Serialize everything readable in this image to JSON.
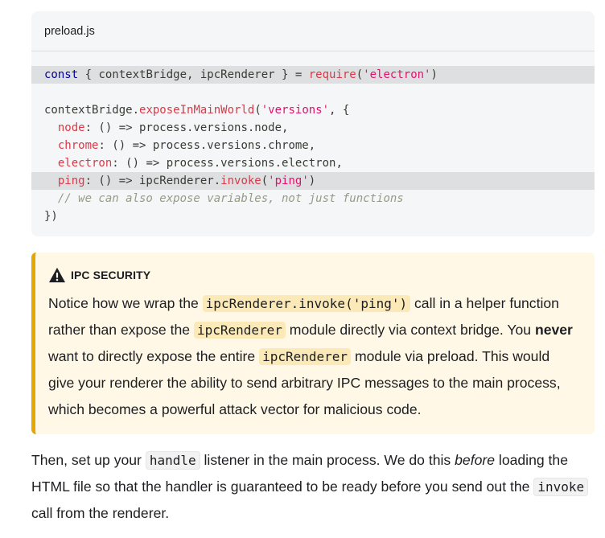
{
  "code_block": {
    "filename": "preload.js",
    "lines": {
      "l1": {
        "a": "const",
        "b": " { contextBridge, ipcRenderer } = ",
        "c": "require",
        "d": "(",
        "e": "'electron'",
        "f": ")"
      },
      "l3": {
        "a": "contextBridge.",
        "b": "exposeInMainWorld",
        "c": "(",
        "d": "'versions'",
        "e": ", {"
      },
      "l4": {
        "a": "  ",
        "b": "node",
        "c": ": () => process.versions.node,"
      },
      "l5": {
        "a": "  ",
        "b": "chrome",
        "c": ": () => process.versions.chrome,"
      },
      "l6": {
        "a": "  ",
        "b": "electron",
        "c": ": () => process.versions.electron,"
      },
      "l7": {
        "a": "  ",
        "b": "ping",
        "c": ": () => ipcRenderer.",
        "d": "invoke",
        "e": "(",
        "f": "'ping'",
        "g": ")"
      },
      "l8": {
        "a": "  ",
        "b": "// we can also expose variables, not just functions"
      },
      "l9": {
        "a": "})"
      }
    }
  },
  "admonition": {
    "title": "IPC SECURITY",
    "t1": "Notice how we wrap the ",
    "c1": "ipcRenderer.invoke('ping')",
    "t2": " call in a helper function rather than expose the ",
    "c2": "ipcRenderer",
    "t3": " module directly via context bridge. You ",
    "b1": "never",
    "t4": " want to directly expose the entire ",
    "c3": "ipcRenderer",
    "t5": " module via preload. This would give your renderer the ability to send arbitrary IPC messages to the main process, which becomes a powerful attack vector for malicious code."
  },
  "paragraph": {
    "t1": "Then, set up your ",
    "c1": "handle",
    "t2": " listener in the main process. We do this ",
    "e1": "before",
    "t3": " loading the HTML file so that the handler is guaranteed to be ready before you send out the ",
    "c2": "invoke",
    "t4": " call from the renderer."
  },
  "colors": {
    "admonition_border": "#e6a700",
    "admonition_bg": "#fff8e6",
    "code_bg": "#f5f6f7"
  }
}
